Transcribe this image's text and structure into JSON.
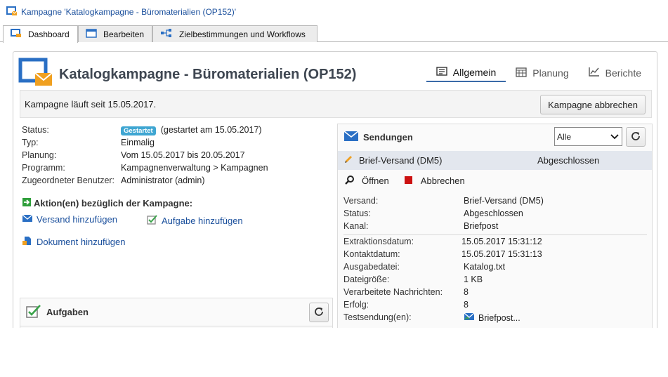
{
  "window": {
    "title": "Kampagne 'Katalogkampagne - Büromaterialien (OP152)'"
  },
  "tabs": [
    {
      "label": "Dashboard"
    },
    {
      "label": "Bearbeiten"
    },
    {
      "label": "Zielbestimmungen und Workflows"
    }
  ],
  "header": {
    "title": "Katalogkampagne - Büromaterialien (OP152)",
    "views": [
      {
        "label": "Allgemein"
      },
      {
        "label": "Planung"
      },
      {
        "label": "Berichte"
      }
    ]
  },
  "status_bar": {
    "text": "Kampagne läuft seit 15.05.2017.",
    "abort_label": "Kampagne abbrechen"
  },
  "properties": {
    "status": {
      "key": "Status:",
      "badge": "Gestartet",
      "value": "(gestartet am 15.05.2017)"
    },
    "type": {
      "key": "Typ:",
      "value": "Einmalig"
    },
    "planning": {
      "key": "Planung:",
      "value": "Vom 15.05.2017 bis 20.05.2017"
    },
    "program": {
      "key": "Programm:",
      "value": "Kampagnenverwaltung > Kampagnen"
    },
    "user": {
      "key": "Zugeordneter Benutzer:",
      "value": "Administrator (admin)"
    }
  },
  "actions": {
    "heading": "Aktion(en) bezüglich der Kampagne:",
    "add_delivery": "Versand hinzufügen",
    "add_task": "Aufgabe hinzufügen",
    "add_document": "Dokument hinzufügen"
  },
  "tasks_panel": {
    "title": "Aufgaben"
  },
  "deliveries_panel": {
    "title": "Sendungen",
    "filter_value": "Alle",
    "delivery": {
      "name": "Brief-Versand (DM5)",
      "state": "Abgeschlossen"
    },
    "open_label": "Öffnen",
    "cancel_label": "Abbrechen",
    "details": [
      {
        "key": "Versand:",
        "value": "Brief-Versand (DM5)"
      },
      {
        "key": "Status:",
        "value": "Abgeschlossen"
      },
      {
        "key": "Kanal:",
        "value": "Briefpost"
      },
      {
        "key": "Extraktionsdatum:",
        "value": "15.05.2017 15:31:12"
      },
      {
        "key": "Kontaktdatum:",
        "value": "15.05.2017 15:31:13"
      },
      {
        "key": "Ausgabedatei:",
        "value": "Katalog.txt"
      },
      {
        "key": "Dateigröße:",
        "value": "1 KB"
      },
      {
        "key": "Verarbeitete Nachrichten:",
        "value": "8"
      },
      {
        "key": "Erfolg:",
        "value": "8"
      },
      {
        "key": "Testsendung(en):",
        "value": "Briefpost..."
      }
    ]
  },
  "colors": {
    "link": "#1a4f9c",
    "badge": "#3fa6d2",
    "accent": "#3a6aa8",
    "stop": "#cc1111"
  }
}
